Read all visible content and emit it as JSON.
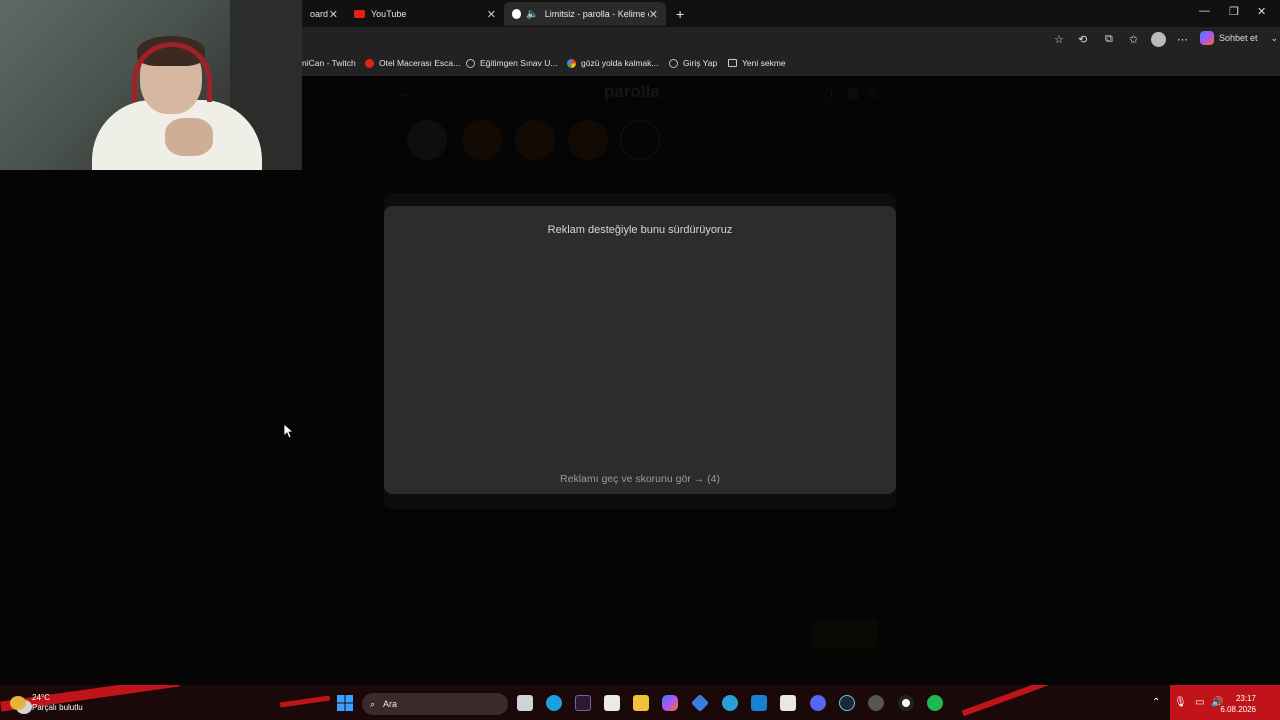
{
  "browser": {
    "tabs": [
      {
        "label": "oard",
        "icon": "twitch-icon"
      },
      {
        "label": "YouTube",
        "icon": "youtube-icon"
      },
      {
        "label": "Limitsiz - parolla - Kelime oyu",
        "icon": "parolla-icon",
        "active": true
      }
    ],
    "new_tab_symbol": "+",
    "copilot_label": "Sohbet et",
    "bookmarks": [
      {
        "label": "niCan - Twitch"
      },
      {
        "label": "Otel Macerası Esca..."
      },
      {
        "label": "Eğitimgen Sınav U..."
      },
      {
        "label": "gözü yolda kalmak..."
      },
      {
        "label": "Giriş Yap"
      },
      {
        "label": "Yeni sekme"
      }
    ]
  },
  "page": {
    "brand": "parolla",
    "modal": {
      "title": "Reklam desteğiyle bunu sürdürüyoruz",
      "skip_label": "Reklamı geç ve skorunu gör → (4)"
    }
  },
  "taskbar": {
    "weather_temp": "24°C",
    "weather_desc": "Parçalı bulutlu",
    "search_label": "Ara",
    "time": "23:17",
    "date": "6.08.2026"
  },
  "colors": {
    "modal_bg": "#2c2c2c",
    "page_bg": "#050505",
    "taskbar_accent": "#c0141a"
  }
}
